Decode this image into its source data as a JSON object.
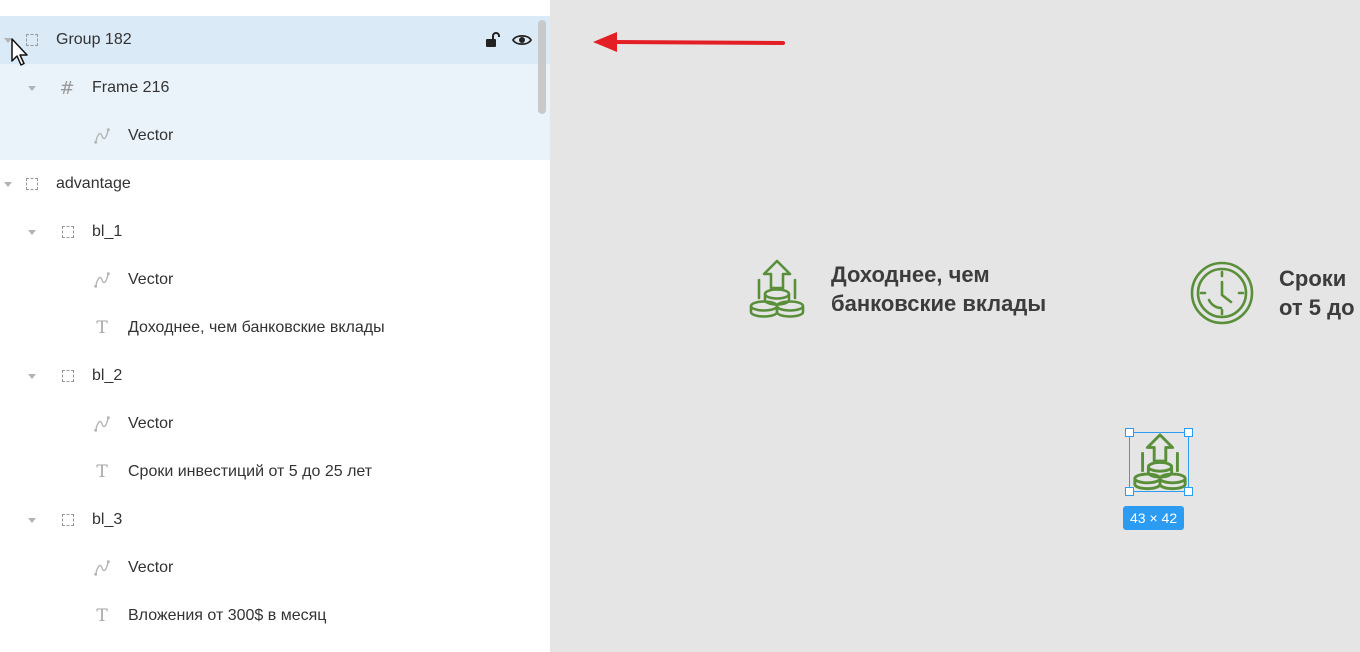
{
  "layers": [
    {
      "name": "Group 182",
      "icon": "group-icon",
      "level": 0,
      "expanded": true,
      "selected": "strong"
    },
    {
      "name": "Frame 216",
      "icon": "frame-icon",
      "level": 1,
      "expanded": true,
      "selected": "light"
    },
    {
      "name": "Vector",
      "icon": "vector-icon",
      "level": 2,
      "selected": "light"
    },
    {
      "name": "advantage",
      "icon": "group-icon",
      "level": 0,
      "expanded": true
    },
    {
      "name": "bl_1",
      "icon": "group-icon",
      "level": 1,
      "expanded": true
    },
    {
      "name": "Vector",
      "icon": "vector-icon",
      "level": 2
    },
    {
      "name": "Доходнее, чем банковские вклады",
      "icon": "text-icon",
      "level": 2
    },
    {
      "name": "bl_2",
      "icon": "group-icon",
      "level": 1,
      "expanded": true
    },
    {
      "name": "Vector",
      "icon": "vector-icon",
      "level": 2
    },
    {
      "name": "Сроки инвестиций от 5 до 25 лет",
      "icon": "text-icon",
      "level": 2
    },
    {
      "name": "bl_3",
      "icon": "group-icon",
      "level": 1,
      "expanded": true
    },
    {
      "name": "Vector",
      "icon": "vector-icon",
      "level": 2
    },
    {
      "name": "Вложения от 300$ в месяц",
      "icon": "text-icon",
      "level": 2
    }
  ],
  "canvas": {
    "advantage_1": {
      "line1": "Доходнее, чем",
      "line2": "банковские вклады"
    },
    "advantage_2": {
      "line1": "Сроки",
      "line2": "от 5 до"
    },
    "selection_label": "43 × 42"
  },
  "colors": {
    "icon_green": "#5a8f3a",
    "selection_blue": "#2b9cf2",
    "arrow_red": "#e31e24",
    "selected_row": "#daeaf7",
    "selected_row_light": "#ebf3fa"
  }
}
